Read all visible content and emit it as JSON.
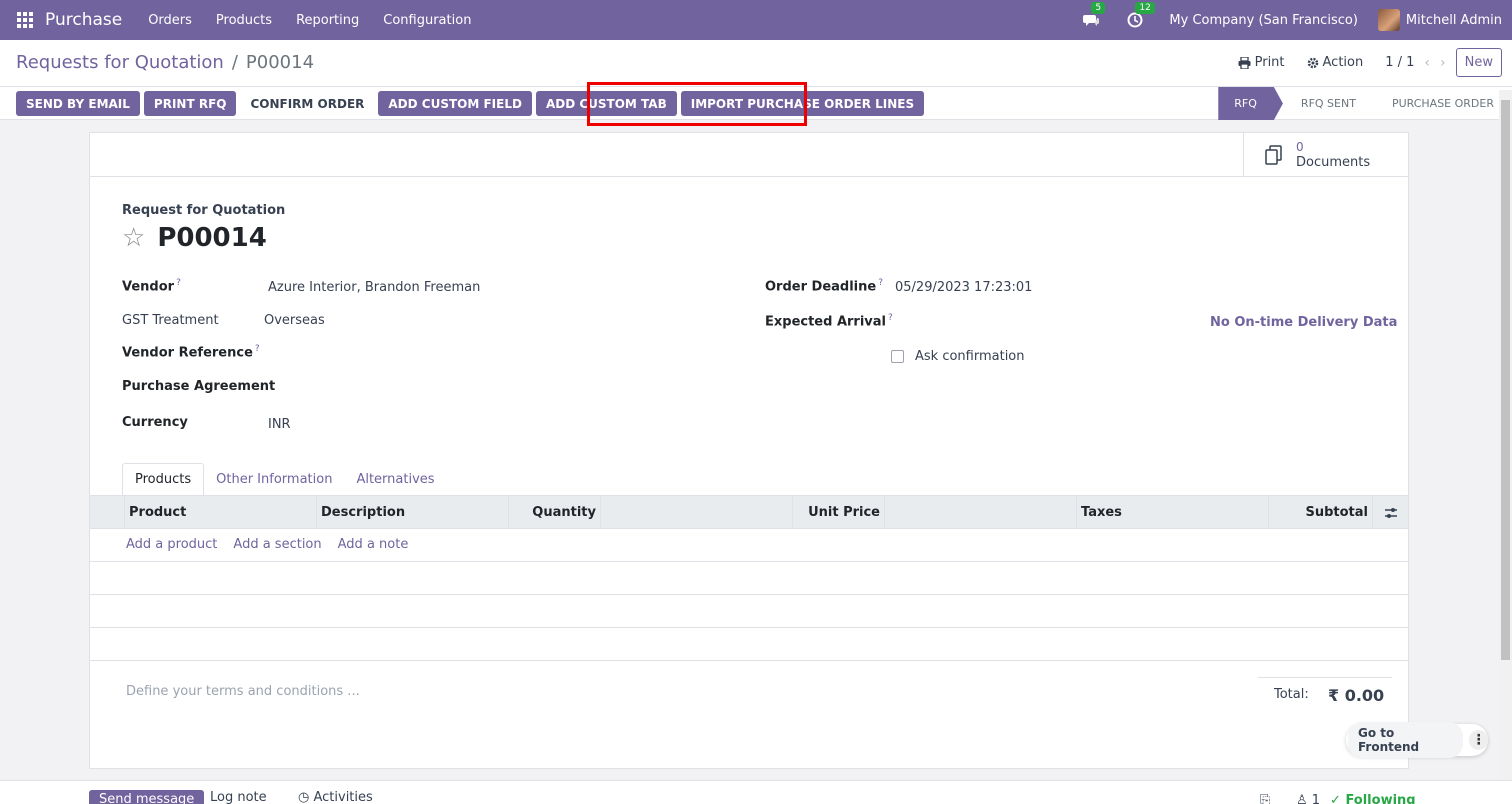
{
  "navbar": {
    "app_name": "Purchase",
    "menu": [
      "Orders",
      "Products",
      "Reporting",
      "Configuration"
    ],
    "messages_count": "5",
    "activities_count": "12",
    "company": "My Company (San Francisco)",
    "user": "Mitchell Admin"
  },
  "control_panel": {
    "breadcrumb_parent": "Requests for Quotation",
    "breadcrumb_sep": "/",
    "breadcrumb_current": "P00014",
    "print_label": "Print",
    "action_label": "Action",
    "pager": "1 / 1",
    "new_label": "New"
  },
  "statusbar": {
    "buttons": {
      "send_email": "SEND BY EMAIL",
      "print_rfq": "PRINT RFQ",
      "confirm_order": "CONFIRM ORDER",
      "add_custom_field": "ADD CUSTOM FIELD",
      "add_custom_tab": "ADD CUSTOM TAB",
      "import_lines": "IMPORT PURCHASE ORDER LINES"
    },
    "stages": [
      "RFQ",
      "RFQ SENT",
      "PURCHASE ORDER"
    ],
    "active_stage": "RFQ"
  },
  "sheet": {
    "documents_count": "0",
    "documents_label": "Documents",
    "title_label": "Request for Quotation",
    "reference": "P00014",
    "fields": {
      "vendor_label": "Vendor",
      "vendor_value": "Azure Interior, Brandon Freeman",
      "gst_label": "GST Treatment",
      "gst_value": "Overseas",
      "vendor_ref_label": "Vendor Reference",
      "agreement_label": "Purchase Agreement",
      "currency_label": "Currency",
      "currency_value": "INR",
      "deadline_label": "Order Deadline",
      "deadline_value": "05/29/2023 17:23:01",
      "arrival_label": "Expected Arrival",
      "ontime_label": "No On-time Delivery Data",
      "ask_confirmation_label": "Ask confirmation",
      "help_mark": "?"
    },
    "tabs": [
      "Products",
      "Other Information",
      "Alternatives"
    ],
    "table": {
      "columns": [
        "Product",
        "Description",
        "Quantity",
        "Unit Price",
        "Taxes",
        "Subtotal"
      ],
      "add_links": [
        "Add a product",
        "Add a section",
        "Add a note"
      ]
    },
    "terms_placeholder": "Define your terms and conditions ...",
    "total_label": "Total:",
    "total_value": "₹ 0.00"
  },
  "chatter": {
    "send_message": "Send message",
    "log_note": "Log note",
    "activities": "Activities",
    "followers_count": "1",
    "following": "Following"
  },
  "frontend": {
    "label": "Go to Frontend"
  },
  "colors": {
    "brand": "#71639e",
    "highlight": "#e00000",
    "success": "#28a745"
  }
}
